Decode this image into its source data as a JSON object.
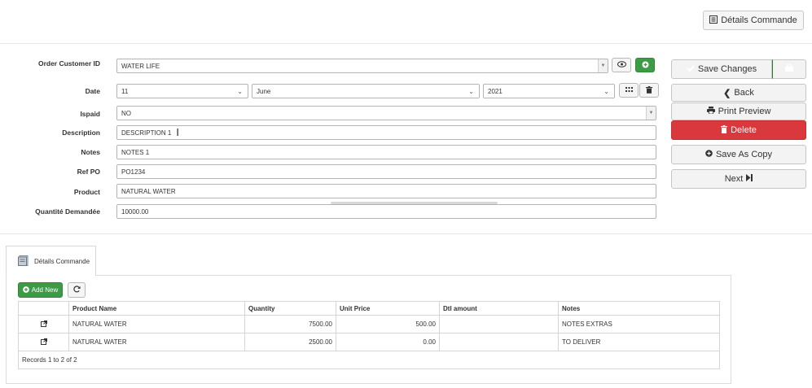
{
  "header": {
    "details_button": "Détails Commande"
  },
  "form": {
    "order_customer_id": {
      "label": "Order Customer ID",
      "value": "WATER LIFE"
    },
    "date": {
      "label": "Date",
      "day": "11",
      "month": "June",
      "year": "2021"
    },
    "ispaid": {
      "label": "Ispaid",
      "value": "NO"
    },
    "description": {
      "label": "Description",
      "value": "DESCRIPTION 1"
    },
    "notes": {
      "label": "Notes",
      "value": "NOTES 1"
    },
    "ref_po": {
      "label": "Ref PO",
      "value": "PO1234"
    },
    "product": {
      "label": "Product",
      "value": "NATURAL WATER"
    },
    "quantite": {
      "label": "Quantité Demandée",
      "value": "10000.00"
    }
  },
  "actions": {
    "save": "Save Changes",
    "back": "Back",
    "print": "Print Preview",
    "delete": "Delete",
    "save_copy": "Save As Copy",
    "next": "Next"
  },
  "details": {
    "tab_label": "Détails Commande",
    "add_new": "Add New",
    "columns": [
      "",
      "Product Name",
      "Quantity",
      "Unit Price",
      "Dtl amount",
      "Notes"
    ],
    "rows": [
      {
        "product": "NATURAL WATER",
        "quantity": "7500.00",
        "unit_price": "500.00",
        "dtl_amount": "",
        "notes": "NOTES EXTRAS"
      },
      {
        "product": "NATURAL WATER",
        "quantity": "2500.00",
        "unit_price": "0.00",
        "dtl_amount": "",
        "notes": "TO DELIVER"
      }
    ],
    "records": "Records 1 to 2 of 2"
  },
  "colors": {
    "primary_green": "#3d9b46",
    "danger_red": "#d9383c"
  }
}
